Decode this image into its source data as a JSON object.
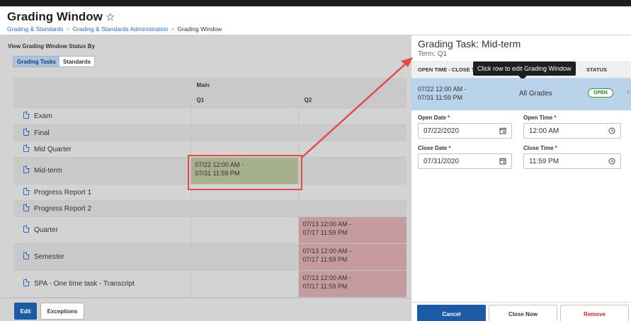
{
  "header": {
    "title": "Grading Window",
    "star_icon": "star-outline-icon",
    "breadcrumb": [
      "Grading & Standards",
      "Grading & Standards Administration",
      "Grading Window"
    ]
  },
  "left": {
    "view_label": "View Grading Window Status By",
    "toggle": {
      "active": "Grading Tasks",
      "inactive": "Standards"
    },
    "group_header": "Main",
    "col_q1": "Q1",
    "col_q2": "Q2",
    "rows": [
      {
        "task": "Exam",
        "q1": "",
        "q2": ""
      },
      {
        "task": "Final",
        "q1": "",
        "q2": ""
      },
      {
        "task": "Mid Quarter",
        "q1": "",
        "q2": ""
      },
      {
        "task": "Mid-term",
        "q1": "07/22 12:00 AM -\n07/31 11:59 PM",
        "q2": ""
      },
      {
        "task": "Progress Report 1",
        "q1": "",
        "q2": ""
      },
      {
        "task": "Progress Report 2",
        "q1": "",
        "q2": ""
      },
      {
        "task": "Quarter",
        "q1": "",
        "q2": "07/13 12:00 AM -\n07/17 11:59 PM"
      },
      {
        "task": "Semester",
        "q1": "",
        "q2": "07/13 12:00 AM -\n07/17 11:59 PM"
      },
      {
        "task": "SPA - One time task - Transcript",
        "q1": "",
        "q2": "07/13 12:00 AM -\n07/17 11:59 PM"
      }
    ],
    "buttons": {
      "edit": "Edit",
      "exceptions": "Exceptions"
    }
  },
  "right": {
    "title": "Grading Task: Mid-term",
    "term": "Term: Q1",
    "col_open_close": "OPEN TIME - CLOSE TIME",
    "col_status": "STATUS",
    "tooltip": "Click row to edit Grading Window",
    "row": {
      "dates_line1": "07/22 12:00 AM -",
      "dates_line2": "07/31 11:59 PM",
      "grades": "All Grades",
      "status": "OPEN"
    },
    "form": {
      "open_date_label": "Open Date",
      "open_date": "07/22/2020",
      "open_time_label": "Open Time",
      "open_time": "12:00 AM",
      "close_date_label": "Close Date",
      "close_date": "07/31/2020",
      "close_time_label": "Close Time",
      "close_time": "11:59 PM",
      "required_mark": "*"
    },
    "buttons": {
      "cancel": "Cancel",
      "close_now": "Close Now",
      "remove": "Remove"
    }
  },
  "colors": {
    "primary": "#1c5aa6",
    "open_status": "#2d7a2d",
    "annotation": "#e34a4a",
    "q1_fill": "#a7b08c",
    "q2_fill": "#c59ba0"
  }
}
